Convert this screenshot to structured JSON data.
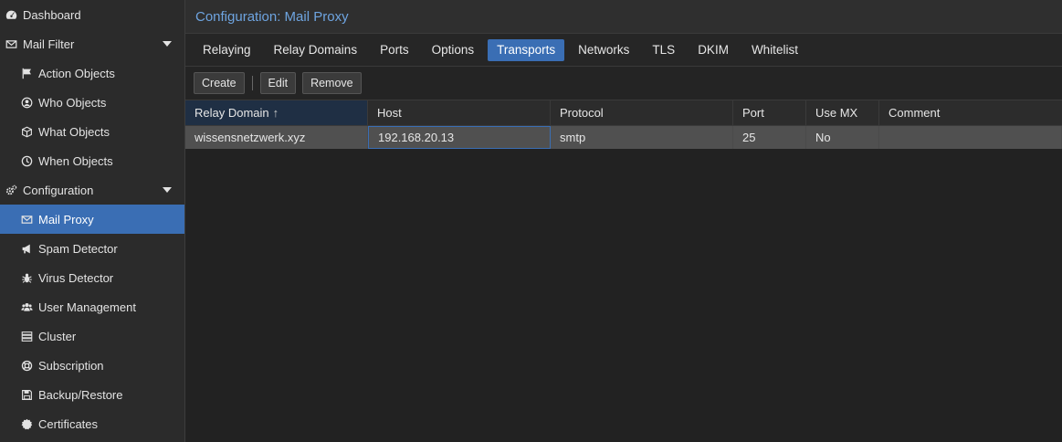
{
  "sidebar": {
    "items": [
      {
        "label": "Dashboard",
        "icon": "dashboard-icon"
      },
      {
        "label": "Mail Filter",
        "icon": "envelope-icon"
      },
      {
        "label": "Action Objects",
        "icon": "flag-icon"
      },
      {
        "label": "Who Objects",
        "icon": "user-circle-icon"
      },
      {
        "label": "What Objects",
        "icon": "cube-icon"
      },
      {
        "label": "When Objects",
        "icon": "clock-icon"
      },
      {
        "label": "Configuration",
        "icon": "cogs-icon"
      },
      {
        "label": "Mail Proxy",
        "icon": "envelope-icon"
      },
      {
        "label": "Spam Detector",
        "icon": "bullhorn-icon"
      },
      {
        "label": "Virus Detector",
        "icon": "bug-icon"
      },
      {
        "label": "User Management",
        "icon": "users-icon"
      },
      {
        "label": "Cluster",
        "icon": "server-icon"
      },
      {
        "label": "Subscription",
        "icon": "life-ring-icon"
      },
      {
        "label": "Backup/Restore",
        "icon": "floppy-icon"
      },
      {
        "label": "Certificates",
        "icon": "certificate-icon"
      }
    ]
  },
  "header": {
    "title": "Configuration: Mail Proxy"
  },
  "tabs": [
    {
      "label": "Relaying"
    },
    {
      "label": "Relay Domains"
    },
    {
      "label": "Ports"
    },
    {
      "label": "Options"
    },
    {
      "label": "Transports"
    },
    {
      "label": "Networks"
    },
    {
      "label": "TLS"
    },
    {
      "label": "DKIM"
    },
    {
      "label": "Whitelist"
    }
  ],
  "toolbar": {
    "create": "Create",
    "edit": "Edit",
    "remove": "Remove"
  },
  "grid": {
    "columns": [
      "Relay Domain",
      "Host",
      "Protocol",
      "Port",
      "Use MX",
      "Comment"
    ],
    "sort_arrow": "↑",
    "rows": [
      [
        "wissensnetzwerk.xyz",
        "192.168.20.13",
        "smtp",
        "25",
        "No",
        ""
      ]
    ]
  },
  "colors": {
    "accent": "#3a6eb4",
    "title": "#6ea4e0"
  }
}
